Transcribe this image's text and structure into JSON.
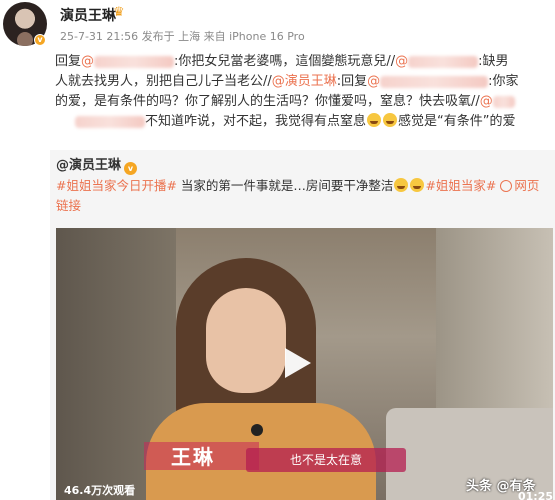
{
  "post": {
    "username": "演员王琳",
    "meta": "25-7-31 21:56 发布于 上海 来自 iPhone 16 Pro"
  },
  "reply": {
    "line1_a": "回复",
    "line1_b": ":你把女兒當老婆嗎，這個變態玩意兒//",
    "line1_c": ":缺男",
    "line2_a": "人就去找男人，别把自己儿子当老公//",
    "line2_mention": "@演员王琳",
    "line2_b": ":回复",
    "line2_c": ":你家",
    "line3": "的爱，是有条件的吗？你了解别人的生活吗？你懂爱吗，窒息？快去吸氧//",
    "line4_a": "不知道咋说，对不起，我觉得有点窒息",
    "line4_b": "感觉是“有条件”的爱"
  },
  "quoted": {
    "author": "@演员王琳",
    "tag1": "#姐姐当家今日开播#",
    "text1": " 当家的第一件事就是…房间要干净整洁",
    "tag2": "#姐姐当家#",
    "link": "网页链接"
  },
  "video": {
    "name_caption": "王琳",
    "subtitle": "也不是太在意",
    "views": "46.4万次观看",
    "duration": "01:25",
    "watermark": "头条 @有条"
  }
}
